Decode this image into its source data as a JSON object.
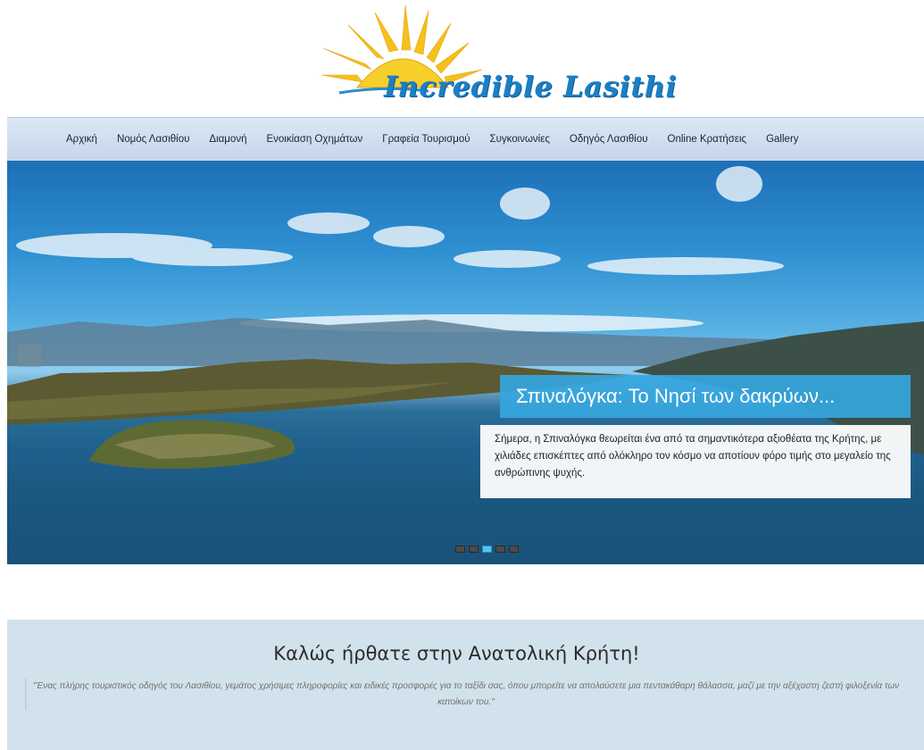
{
  "logo": {
    "text": "Incredible Lasithi",
    "icon": "sun-icon",
    "sun_color": "#f5c01a",
    "text_color": "#1c7fc4"
  },
  "nav": {
    "items": [
      "Αρχική",
      "Νομός Λασιθίου",
      "Διαμονή",
      "Ενοικίαση Οχημάτων",
      "Γραφεία Τουρισμού",
      "Συγκοινωνίες",
      "Οδηγός Λασιθίου",
      "Online Κρατήσεις",
      "Gallery"
    ]
  },
  "slider": {
    "caption_title": "Σπιναλόγκα: Το Νησί των δακρύων...",
    "caption_text": "Σήμερα, η Σπιναλόγκα θεωρείται ένα από τα σημαντικότερα αξιοθέατα της Κρήτης, με χιλιάδες επισκέπτες από ολόκληρο τον κόσμο να αποτίουν φόρο τιμής στο μεγαλείο της ανθρώπινης ψυχής.",
    "slide_count": 5,
    "active_slide": 3,
    "caption_color": "#35a6de"
  },
  "welcome": {
    "title": "Καλώς ήρθατε στην Ανατολική Κρήτη!",
    "quote": "\"Ένας πλήρης τουριστικός οδηγός του Λασιθίου, γεμάτος χρήσιμες πληροφορίες και ειδικές προσφορές για το ταξίδι σας, όπου μπορείτε να απολαύσετε μια πεντακάθαρη θάλασσα, μαζί με την αξέχαστη ζεστή φιλοξενία των κατοίκων του.\"",
    "background": "#d2e2ec"
  }
}
